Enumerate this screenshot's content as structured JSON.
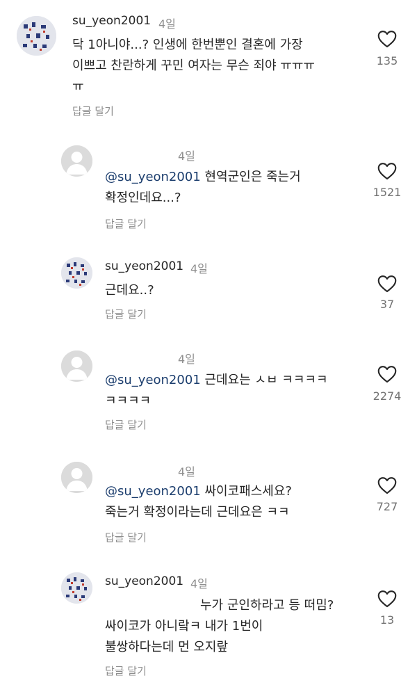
{
  "comments": [
    {
      "username": "su_yeon2001",
      "time": "4일",
      "lines": [
        "닥 1아니야...? 인생에 한번뿐인 결혼에 가장",
        "이쁘고 찬란하게 꾸민 여자는 무슨 죄야 ㅠㅠㅠ",
        "ㅠ"
      ],
      "reply_label": "답글 달기",
      "likes": "135"
    },
    {
      "username": "",
      "time": "4일",
      "mention": "@su_yeon2001",
      "lines": [
        " 현역군인은 죽는거",
        "확정인데요...?"
      ],
      "reply_label": "답글 달기",
      "likes": "1521"
    },
    {
      "username": "su_yeon2001",
      "time": "4일",
      "lines": [
        "근데요..?"
      ],
      "reply_label": "답글 달기",
      "likes": "37"
    },
    {
      "username": "",
      "time": "4일",
      "mention": "@su_yeon2001",
      "lines": [
        " 근데요는 ㅅㅂ ㅋㅋㅋㅋ",
        "ㅋㅋㅋㅋ"
      ],
      "reply_label": "답글 달기",
      "likes": "2274"
    },
    {
      "username": "",
      "time": "4일",
      "mention": "@su_yeon2001",
      "lines": [
        " 싸이코패스세요?",
        "죽는거 확정이라는데 근데요은 ㅋㅋ"
      ],
      "reply_label": "답글 달기",
      "likes": "727"
    },
    {
      "username": "su_yeon2001",
      "time": "4일",
      "lines": [
        "누가 군인하라고 등 떠밈?",
        "싸이코가 아니랔ㅋ 내가 1번이",
        "불쌍하다는데 먼 오지랖"
      ],
      "reply_label": "답글 달기",
      "likes": "13"
    }
  ],
  "icons": {
    "like": "heart-outline-icon",
    "avatar_default": "default-avatar-icon",
    "avatar_user": "patterned-avatar"
  },
  "colors": {
    "text": "#262626",
    "secondary": "#8e8e8e",
    "mention": "#1c3e6e",
    "avatar_blank": "#dbdbdb"
  }
}
